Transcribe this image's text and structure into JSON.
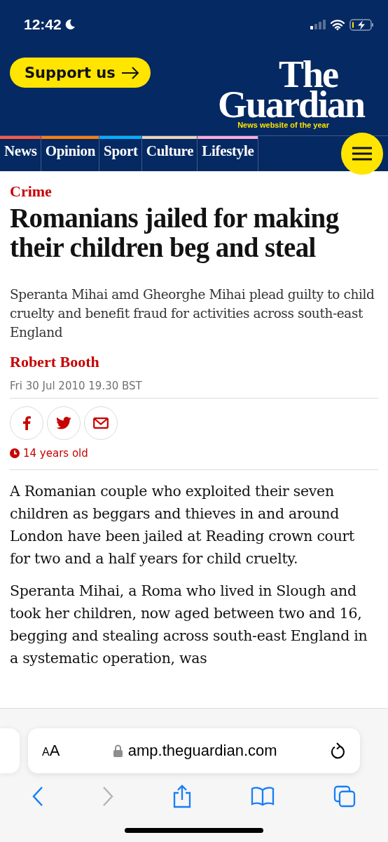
{
  "status_bar": {
    "time": "12:42"
  },
  "header": {
    "support_button": "Support us",
    "logo_line_1": "The",
    "logo_line_2": "Guardian",
    "tagline": "News website of the year"
  },
  "nav": [
    {
      "label": "News",
      "color": "#ff5943"
    },
    {
      "label": "Opinion",
      "color": "#ff7f0f"
    },
    {
      "label": "Sport",
      "color": "#00b2ff"
    },
    {
      "label": "Culture",
      "color": "#e7d4b9"
    },
    {
      "label": "Lifestyle",
      "color": "#ffabdb"
    }
  ],
  "article": {
    "section": "Crime",
    "headline": "Romanians jailed for making their children beg and steal",
    "standfirst": "Speranta Mihai amd Gheorghe Mihai plead guilty to child cruelty and benefit fraud for activities across south-east England",
    "byline": "Robert Booth",
    "dateline": "Fri 30 Jul 2010 19.30 BST",
    "age": "14 years old",
    "paragraphs": [
      "A Romanian couple who exploited their seven children as beggars and thieves in and around London have been jailed at Reading crown court for two and a half years for child cruelty.",
      "Speranta Mihai, a Roma who lived in Slough and took her children, now aged between two and 16, begging and stealing across south-east England in a systematic operation, was"
    ]
  },
  "browser": {
    "text_size_button": "AA",
    "url": "amp.theguardian.com",
    "back_disabled": false,
    "forward_disabled": true
  }
}
